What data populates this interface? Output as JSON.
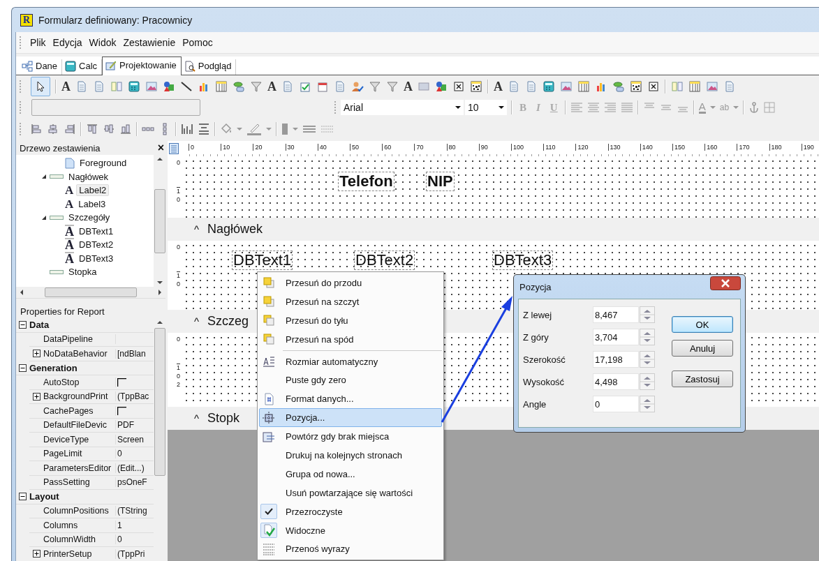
{
  "window": {
    "title": "Formularz definiowany: Pracownicy",
    "app_icon": "R"
  },
  "menu": [
    "Plik",
    "Edycja",
    "Widok",
    "Zestawienie",
    "Pomoc"
  ],
  "tabs": [
    {
      "label": "Dane",
      "kind": "data",
      "selected": false
    },
    {
      "label": "Calc",
      "kind": "calc",
      "selected": false
    },
    {
      "label": "Projektowanie",
      "kind": "design",
      "selected": true
    },
    {
      "label": "Podgląd",
      "kind": "preview",
      "selected": false
    }
  ],
  "toolbar_1": [
    {
      "kind": "pointer",
      "selected": true
    },
    {
      "kind": "sep"
    },
    {
      "kind": "letter",
      "glyph": "A"
    },
    {
      "kind": "doc"
    },
    {
      "kind": "doc"
    },
    {
      "kind": "list"
    },
    {
      "kind": "calc"
    },
    {
      "kind": "image"
    },
    {
      "kind": "shapes"
    },
    {
      "kind": "line"
    },
    {
      "kind": "chart"
    },
    {
      "kind": "table"
    },
    {
      "kind": "db"
    },
    {
      "kind": "funnel"
    },
    {
      "kind": "letter",
      "glyph": "A"
    },
    {
      "kind": "doc"
    },
    {
      "kind": "check"
    },
    {
      "kind": "calendar"
    },
    {
      "kind": "doc"
    },
    {
      "kind": "person"
    },
    {
      "kind": "funnel"
    },
    {
      "kind": "funnel"
    },
    {
      "kind": "letter",
      "glyph": "A"
    },
    {
      "kind": "grid"
    },
    {
      "kind": "shapes"
    },
    {
      "kind": "xbox"
    },
    {
      "kind": "barcode"
    },
    {
      "kind": "sep"
    },
    {
      "kind": "letter",
      "glyph": "A"
    },
    {
      "kind": "doc"
    },
    {
      "kind": "doc"
    },
    {
      "kind": "calc"
    },
    {
      "kind": "image"
    },
    {
      "kind": "table"
    },
    {
      "kind": "chart"
    },
    {
      "kind": "db"
    },
    {
      "kind": "barcode"
    },
    {
      "kind": "xbox"
    },
    {
      "kind": "sep"
    },
    {
      "kind": "list"
    },
    {
      "kind": "table"
    },
    {
      "kind": "image"
    },
    {
      "kind": "doc"
    }
  ],
  "font": {
    "family": "Arial",
    "size": "10"
  },
  "format_buttons": [
    {
      "glyph": "B",
      "kind": "bold",
      "disabled": true
    },
    {
      "glyph": "I",
      "kind": "italic",
      "disabled": true
    },
    {
      "glyph": "U",
      "kind": "underline",
      "disabled": true
    }
  ],
  "color_buttons": [
    {
      "glyph": "A",
      "kind": "font-color"
    },
    {
      "glyph": "ab",
      "kind": "highlight"
    }
  ],
  "tree": {
    "title": "Drzewo zestawienia",
    "close": "×",
    "items": [
      {
        "children": [
          {
            "label": "Foreground",
            "kind": "page"
          }
        ]
      },
      {
        "label": "Nagłówek",
        "kind": "band",
        "expanded": true,
        "children": [
          {
            "label": "Label2",
            "kind": "label",
            "glyph": "A",
            "selected": true
          },
          {
            "label": "Label3",
            "kind": "label",
            "glyph": "A",
            "selected": false
          }
        ]
      },
      {
        "label": "Szczegóły",
        "kind": "band",
        "expanded": true,
        "children": [
          {
            "label": "DBText1",
            "kind": "dbtext",
            "glyph": "A",
            "selected": false
          },
          {
            "label": "DBText2",
            "kind": "dbtext",
            "glyph": "A",
            "selected": false
          },
          {
            "label": "DBText3",
            "kind": "dbtext",
            "glyph": "A",
            "selected": false
          }
        ]
      },
      {
        "label": "Stopka",
        "kind": "band"
      }
    ]
  },
  "properties": {
    "title": "Properties for Report",
    "groups": [
      {
        "name": "Data",
        "expanded": true,
        "rows": [
          {
            "name": "DataPipeline",
            "kind": "text",
            "value": ""
          },
          {
            "name": "NoDataBehavior",
            "kind": "expandable",
            "value": "[ndBlan"
          }
        ]
      },
      {
        "name": "Generation",
        "expanded": true,
        "rows": [
          {
            "name": "AutoStop",
            "kind": "checkbox",
            "checked": false
          },
          {
            "name": "BackgroundPrint",
            "kind": "expandable",
            "value": "(TppBac"
          },
          {
            "name": "CachePages",
            "kind": "checkbox",
            "checked": false
          },
          {
            "name": "DefaultFileDevic",
            "kind": "text",
            "value": "PDF"
          },
          {
            "name": "DeviceType",
            "kind": "text",
            "value": "Screen"
          },
          {
            "name": "PageLimit",
            "kind": "text",
            "value": "0"
          },
          {
            "name": "ParametersEditor",
            "kind": "text",
            "value": "(Edit...)"
          },
          {
            "name": "PassSetting",
            "kind": "text",
            "value": "psOneF"
          }
        ]
      },
      {
        "name": "Layout",
        "expanded": true,
        "rows": [
          {
            "name": "ColumnPositions",
            "kind": "text",
            "value": "(TString"
          },
          {
            "name": "Columns",
            "kind": "text",
            "value": "1"
          },
          {
            "name": "ColumnWidth",
            "kind": "text",
            "value": "0"
          },
          {
            "name": "PrinterSetup",
            "kind": "expandable",
            "value": "(TppPri"
          }
        ]
      }
    ]
  },
  "design": {
    "ruler": [
      "0",
      "10",
      "20",
      "30",
      "40",
      "50",
      "60",
      "70",
      "80",
      "90",
      "100",
      "110",
      "120",
      "130",
      "140",
      "150",
      "160",
      "170",
      "180",
      "190"
    ],
    "bands": [
      {
        "ruler": [
          "0",
          "1",
          "0"
        ],
        "label": "Nagłówek",
        "objects": [
          {
            "text": "Telefon",
            "kind": "label"
          },
          {
            "text": "NIP",
            "kind": "label"
          }
        ]
      },
      {
        "ruler": [
          "0",
          "1",
          "0"
        ],
        "label": "Szczeg",
        "objects": [
          {
            "text": "DBText1",
            "kind": "dbtext"
          },
          {
            "text": "DBText2",
            "kind": "dbtext"
          },
          {
            "text": "DBText3",
            "kind": "dbtext"
          }
        ]
      },
      {
        "ruler": [
          "0",
          "1",
          "0",
          "2"
        ],
        "label": "Stopk"
      }
    ],
    "collapse_glyph": "^"
  },
  "context_menu": [
    {
      "label": "Przesuń do przodu",
      "kind": "front",
      "selected": false,
      "checked": false
    },
    {
      "label": "Przesuń na szczyt",
      "kind": "front",
      "selected": false,
      "checked": false
    },
    {
      "label": "Przesuń do tyłu",
      "kind": "back",
      "selected": false,
      "checked": false
    },
    {
      "label": "Przesuń na spód",
      "kind": "back",
      "selected": false,
      "checked": false
    },
    {
      "kind": "separator"
    },
    {
      "label": "Rozmiar automatyczny",
      "kind": "autosize",
      "selected": false,
      "checked": false
    },
    {
      "label": "Puste gdy zero",
      "kind": "plain",
      "selected": false,
      "checked": false
    },
    {
      "label": "Format danych...",
      "kind": "format",
      "selected": false,
      "checked": false
    },
    {
      "label": "Pozycja...",
      "kind": "position",
      "selected": true,
      "checked": false
    },
    {
      "label": "Powtórz gdy brak miejsca",
      "kind": "repeat",
      "selected": false,
      "checked": false
    },
    {
      "label": "Drukuj na kolejnych stronach",
      "kind": "plain",
      "selected": false,
      "checked": false
    },
    {
      "label": "Grupa od nowa...",
      "kind": "plain",
      "selected": false,
      "checked": false
    },
    {
      "label": "Usuń powtarzające się wartości",
      "kind": "plain",
      "selected": false,
      "checked": false
    },
    {
      "label": "Przezroczyste",
      "kind": "plain",
      "selected": false,
      "checked": true
    },
    {
      "label": "Widoczne",
      "kind": "visible",
      "selected": false,
      "checked": true
    },
    {
      "label": "Przenoś wyrazy",
      "kind": "wrap",
      "selected": false,
      "checked": false
    }
  ],
  "dialog": {
    "title": "Pozycja",
    "fields": [
      {
        "label": "Z lewej",
        "value": "8,467"
      },
      {
        "label": "Z góry",
        "value": "3,704"
      },
      {
        "label": "Szerokość",
        "value": "17,198"
      },
      {
        "label": "Wysokość",
        "value": "4,498"
      },
      {
        "label": "Angle",
        "value": "0"
      }
    ],
    "buttons": [
      {
        "label": "OK",
        "default": true
      },
      {
        "label": "Anuluj",
        "default": false
      },
      {
        "label": "Zastosuj",
        "default": false
      }
    ]
  }
}
